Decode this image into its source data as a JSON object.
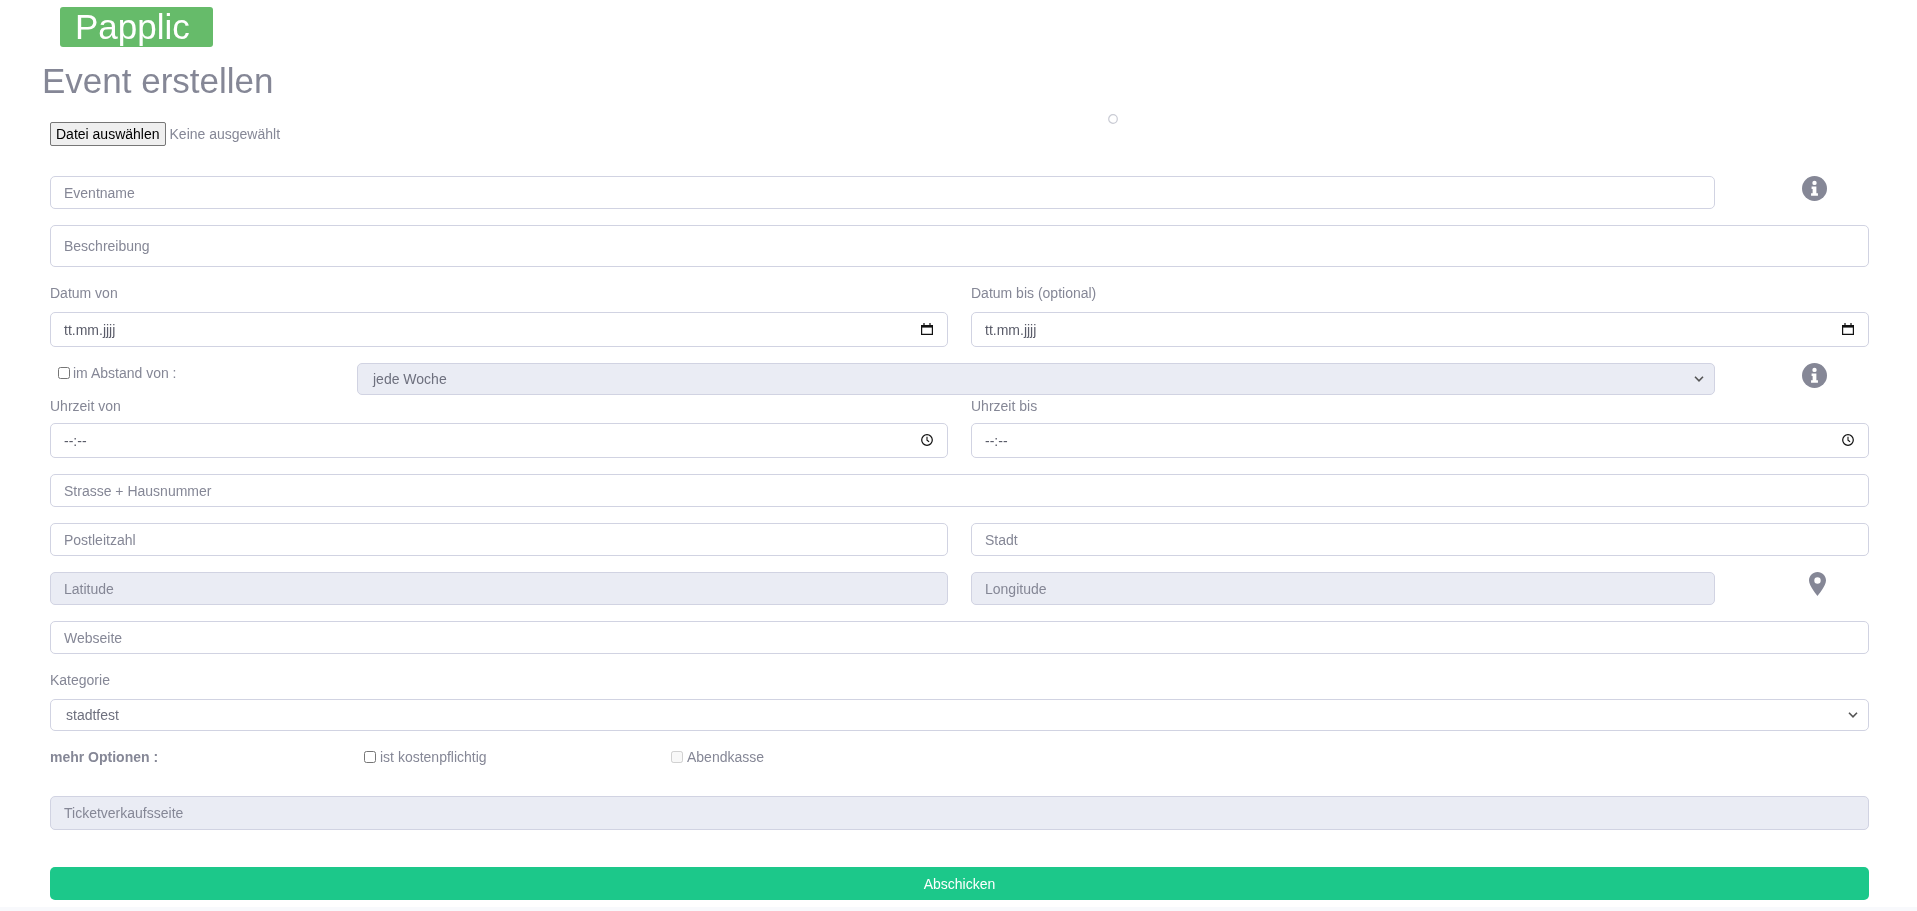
{
  "logo": {
    "text": "Papplic"
  },
  "page_title": "Event erstellen",
  "file_picker": {
    "button": "Datei auswählen",
    "status": "Keine ausgewählt"
  },
  "event_name": {
    "placeholder": "Eventname",
    "disabled": false
  },
  "description": {
    "placeholder": "Beschreibung",
    "disabled": false
  },
  "date_from": {
    "label": "Datum von",
    "placeholder": "tt.mm.jjjj"
  },
  "date_to": {
    "label": "Datum bis (optional)",
    "placeholder": "tt.mm.jjjj"
  },
  "repeat": {
    "label": "im Abstand von :",
    "checked": false,
    "interval": {
      "value": "jede Woche",
      "disabled": true
    }
  },
  "time_from": {
    "label": "Uhrzeit von",
    "placeholder": "--:--"
  },
  "time_to": {
    "label": "Uhrzeit bis",
    "placeholder": "--:--"
  },
  "street": {
    "placeholder": "Strasse + Hausnummer",
    "disabled": false
  },
  "postal_code": {
    "placeholder": "Postleitzahl",
    "disabled": false
  },
  "city": {
    "placeholder": "Stadt",
    "disabled": false
  },
  "latitude": {
    "placeholder": "Latitude",
    "disabled": true
  },
  "longitude": {
    "placeholder": "Longitude",
    "disabled": true
  },
  "website": {
    "placeholder": "Webseite",
    "disabled": false
  },
  "category": {
    "label": "Kategorie",
    "value": "stadtfest",
    "disabled": false
  },
  "more_options": {
    "label": "mehr Optionen :",
    "options": [
      {
        "label": "ist kostenpflichtig",
        "checked": false,
        "disabled": false
      },
      {
        "label": "Abendkasse",
        "checked": false,
        "disabled": true
      }
    ]
  },
  "ticket_site": {
    "placeholder": "Ticketverkaufsseite",
    "disabled": true
  },
  "submit": {
    "label": "Abschicken"
  }
}
